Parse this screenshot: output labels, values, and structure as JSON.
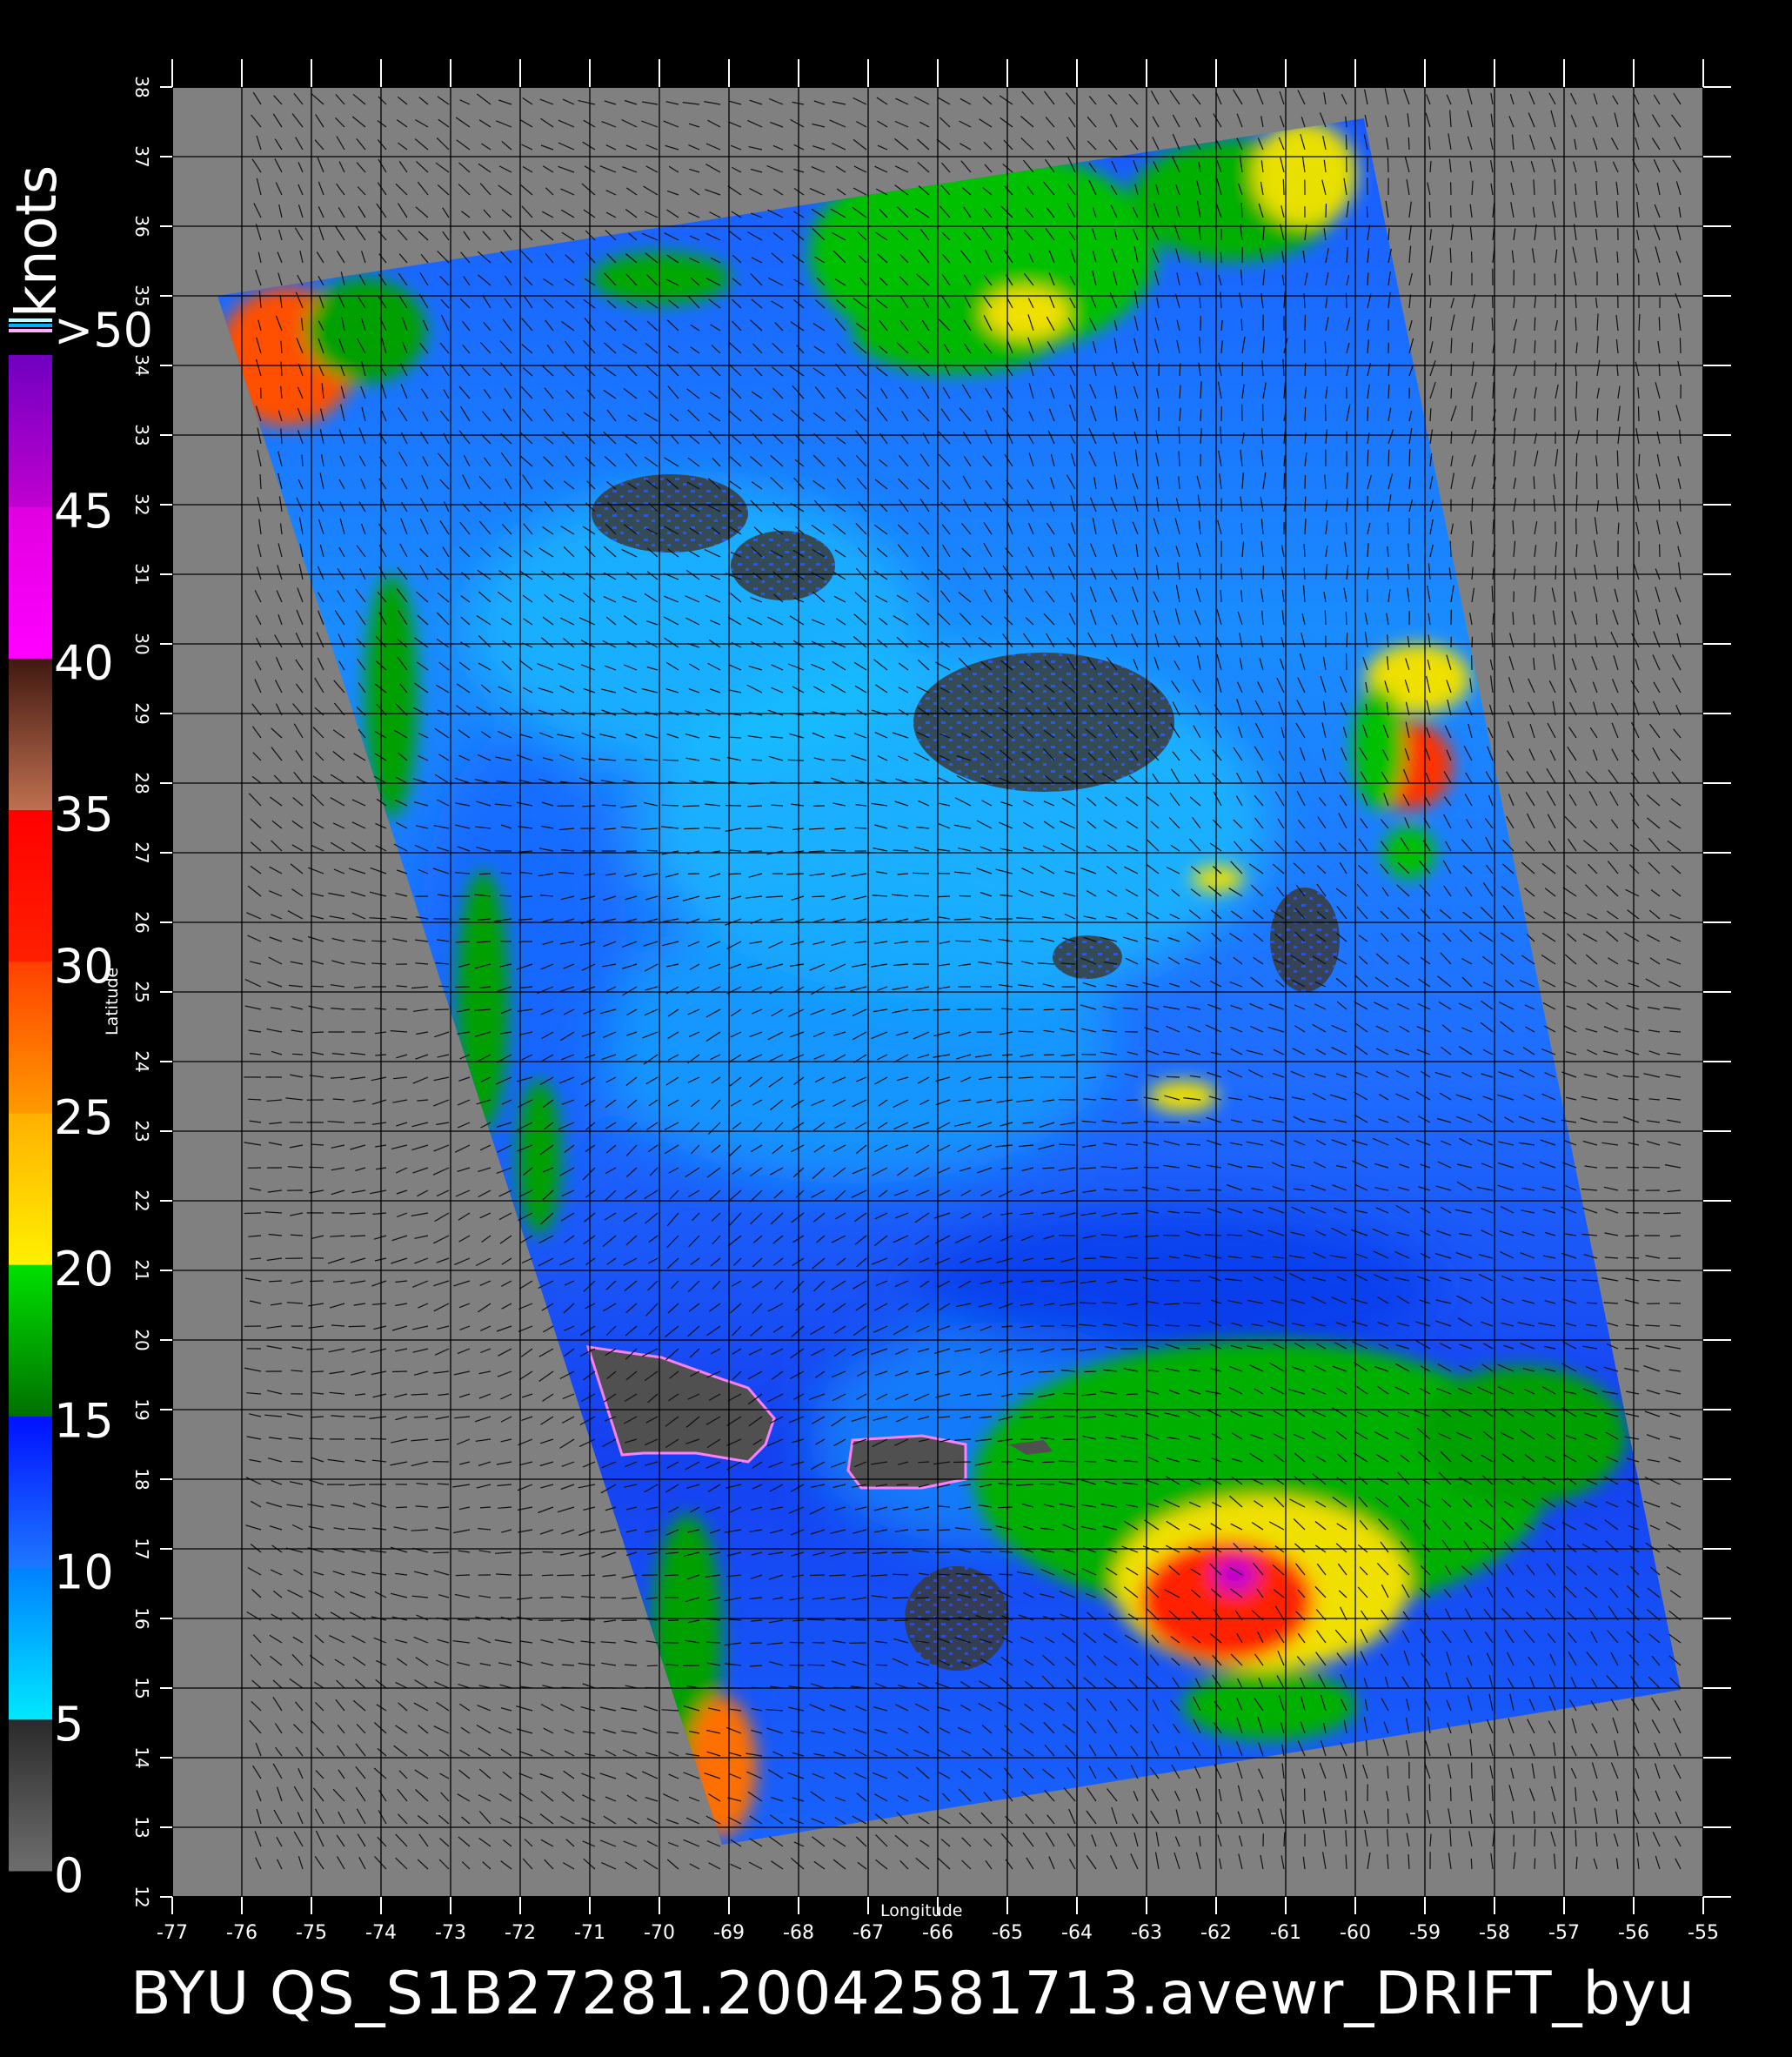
{
  "colorbar": {
    "unit": "knots",
    "top_label": ">50",
    "bands": [
      {
        "from": 0,
        "to": 5,
        "color_low": "#6e6e6e",
        "color_high": "#2a2a2a"
      },
      {
        "from": 5,
        "to": 10,
        "color_low": "#00e8ff",
        "color_high": "#0080ff"
      },
      {
        "from": 10,
        "to": 15,
        "color_low": "#1e78ff",
        "color_high": "#0010ff"
      },
      {
        "from": 15,
        "to": 20,
        "color_low": "#007000",
        "color_high": "#00e000"
      },
      {
        "from": 20,
        "to": 25,
        "color_low": "#fff000",
        "color_high": "#ffb000"
      },
      {
        "from": 25,
        "to": 30,
        "color_low": "#ff9a00",
        "color_high": "#ff4000"
      },
      {
        "from": 30,
        "to": 35,
        "color_low": "#ff2000",
        "color_high": "#ff0000"
      },
      {
        "from": 35,
        "to": 40,
        "color_low": "#c07050",
        "color_high": "#401810"
      },
      {
        "from": 40,
        "to": 45,
        "color_low": "#ff00ff",
        "color_high": "#e000e0"
      },
      {
        "from": 45,
        "to": 50,
        "color_low": "#c000d0",
        "color_high": "#7000c0"
      }
    ],
    "tick_labels": [
      "0",
      "5",
      "10",
      "15",
      "20",
      "25",
      "30",
      "35",
      "40",
      "45"
    ]
  },
  "map": {
    "x_ticks": [
      "-77",
      "-76",
      "-75",
      "-74",
      "-73",
      "-72",
      "-71",
      "-70",
      "-69",
      "-68",
      "-67",
      "-66",
      "-65",
      "-64",
      "-63",
      "-62",
      "-61",
      "-60",
      "-59",
      "-58",
      "-57",
      "-56",
      "-55"
    ],
    "y_ticks": [
      "12",
      "13",
      "14",
      "15",
      "16",
      "17",
      "18",
      "19",
      "20",
      "21",
      "22",
      "23",
      "24",
      "25",
      "26",
      "27",
      "28",
      "29",
      "30",
      "31",
      "32",
      "33",
      "34",
      "35",
      "36",
      "37",
      "38"
    ],
    "xlabel": "Longitude",
    "ylabel": "Latitude",
    "lon_range": [
      -77,
      -55
    ],
    "lat_range": [
      12,
      38
    ],
    "background_color": "#808080",
    "land_color": "#505050",
    "grid_color": "#000000"
  },
  "caption": "BYU QS_S1B27281.20042581713.avewr_DRIFT_byu"
}
